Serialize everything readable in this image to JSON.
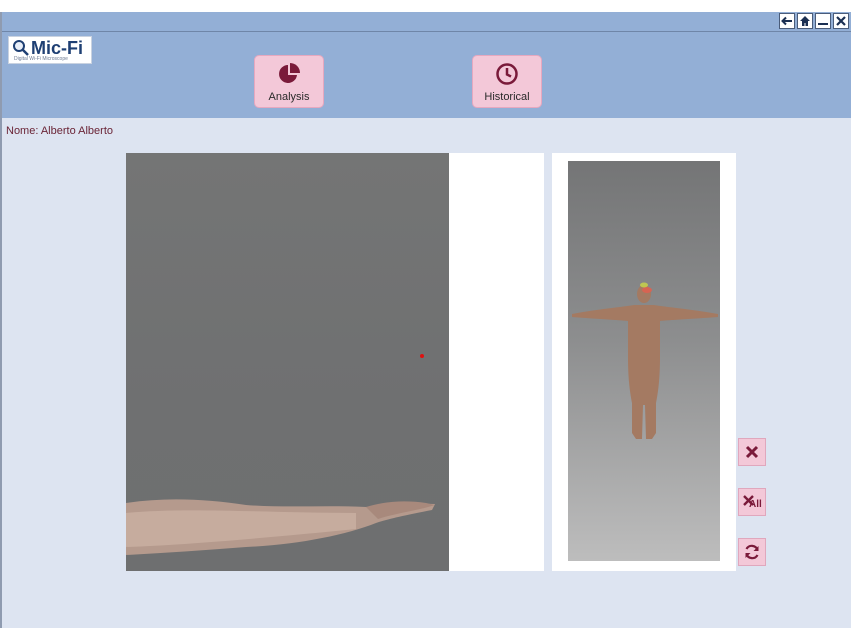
{
  "titlebar": {
    "buttons": [
      {
        "name": "back",
        "icon": "arrow-left-icon"
      },
      {
        "name": "home",
        "icon": "home-icon"
      },
      {
        "name": "minimize",
        "icon": "minimize-icon"
      },
      {
        "name": "close",
        "icon": "close-icon"
      }
    ]
  },
  "logo": {
    "text": "Mic-Fi",
    "subtitle": "Digital Wi-Fi Microscope"
  },
  "nav": {
    "analysis_label": "Analysis",
    "historical_label": "Historical"
  },
  "patient": {
    "label": "Nome: Alberto Alberto"
  },
  "side_actions": {
    "delete_icon": "close-x-icon",
    "delete_all_label": "All",
    "refresh_icon": "refresh-icon"
  },
  "colors": {
    "accent": "#f3c8d8",
    "icon": "#7a1a3a",
    "header": "#93afd6",
    "background": "#dde4f1"
  }
}
